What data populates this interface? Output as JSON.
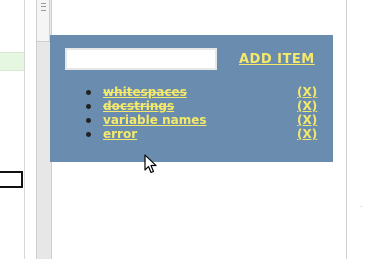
{
  "widget": {
    "input_value": "",
    "input_placeholder": "",
    "add_button_label": "ADD ITEM",
    "items": [
      {
        "label": "whitespaces",
        "completed": true,
        "remove_label": "(X)"
      },
      {
        "label": "docstrings",
        "completed": true,
        "remove_label": "(X)"
      },
      {
        "label": "variable names",
        "completed": false,
        "remove_label": "(X)"
      },
      {
        "label": "error",
        "completed": false,
        "remove_label": "(X)"
      }
    ]
  },
  "colors": {
    "panel_background": "#6a8caf",
    "link_yellow": "#f5e96a",
    "page_background": "#ffffff"
  },
  "icons": {
    "cursor": "arrow-cursor-icon",
    "bullet": "bullet-icon",
    "scroll_grip": "scroll-grip-icon"
  }
}
